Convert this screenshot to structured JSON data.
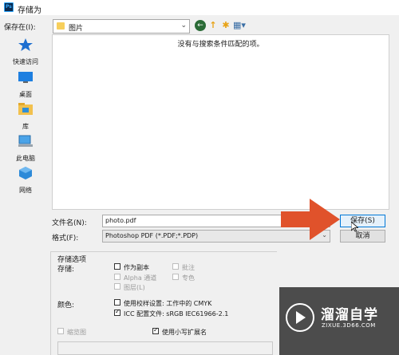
{
  "window": {
    "title": "存储为"
  },
  "toolbar": {
    "save_in_label": "保存在(I):",
    "current_folder": "图片",
    "back_icon": "back-arrow-icon",
    "up_icon": "up-folder-icon",
    "new_folder_icon": "new-folder-icon",
    "views_icon": "views-menu-icon"
  },
  "places": [
    {
      "label": "快速访问",
      "icon": "star-icon"
    },
    {
      "label": "桌面",
      "icon": "desktop-icon"
    },
    {
      "label": "库",
      "icon": "library-icon"
    },
    {
      "label": "此电脑",
      "icon": "computer-icon"
    },
    {
      "label": "网络",
      "icon": "network-icon"
    }
  ],
  "filelist": {
    "empty_message": "没有与搜索条件匹配的项。"
  },
  "filename": {
    "label": "文件名(N):",
    "value": "photo.pdf"
  },
  "format": {
    "label": "格式(F):",
    "value": "Photoshop PDF (*.PDF;*.PDP)"
  },
  "buttons": {
    "save": "保存(S)",
    "cancel": "取消"
  },
  "options": {
    "title": "存储选项",
    "store_label": "存储:",
    "as_copy": {
      "label": "作为副本",
      "checked": false
    },
    "notes": {
      "label": "批注",
      "checked": false
    },
    "alpha": {
      "label": "Alpha 通道",
      "checked": false
    },
    "spot": {
      "label": "专色",
      "checked": false
    },
    "layers": {
      "label": "图层(L)",
      "checked": false
    },
    "color_label": "颜色:",
    "proof": {
      "label": "使用校样设置: 工作中的 CMYK",
      "checked": false
    },
    "icc": {
      "label": "ICC 配置文件: sRGB IEC61966-2.1",
      "checked": true
    },
    "thumbnail": {
      "label": "缩览图",
      "checked": false
    },
    "lowercase_ext": {
      "label": "使用小写扩展名",
      "checked": true
    }
  },
  "watermark": {
    "title": "溜溜自学",
    "subtitle": "ZIXUE.3D66.COM"
  },
  "colors": {
    "accent": "#0078d7",
    "arrow": "#e0522b",
    "ps_icon": "#31a8ff"
  }
}
